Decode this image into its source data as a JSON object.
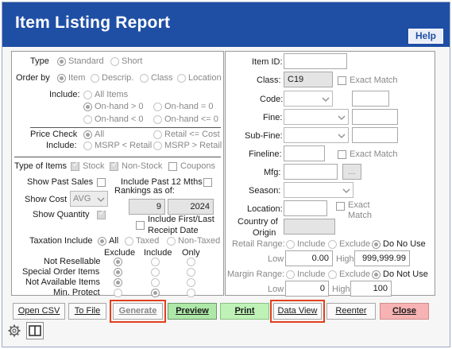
{
  "window": {
    "title": "Item Listing Report",
    "help_label": "Help"
  },
  "left": {
    "type_label": "Type",
    "type_opts": [
      "Standard",
      "Short"
    ],
    "orderby_label": "Order by",
    "orderby_opts": [
      "Item",
      "Descrip.",
      "Class",
      "Location"
    ],
    "include_label": "Include:",
    "include_opts": [
      "All Items",
      "On-hand > 0",
      "On-hand = 0",
      "On-hand < 0",
      "On-hand <= 0"
    ],
    "pricecheck_label1": "Price Check",
    "pricecheck_label2": "Include:",
    "pricecheck_opts": [
      "All",
      "Retail <= Cost",
      "MSRP < Retail",
      "MSRP > Retail"
    ],
    "typeitems_label": "Type of Items",
    "typeitems_opts": [
      "Stock",
      "Non-Stock",
      "Coupons"
    ],
    "show_past_sales": "Show Past Sales",
    "include_past12": "Include Past 12 Mths",
    "show_cost": "Show Cost",
    "cost_value": "AVG",
    "rankings_label": "Rankings as of:",
    "rank_month": "9",
    "rank_year": "2024",
    "show_quantity": "Show Quantity",
    "include_first_last1": "Include First/Last",
    "include_first_last2": "Receipt Date",
    "taxation_label": "Taxation Include",
    "tax_opts": [
      "All",
      "Taxed",
      "Non-Taxed"
    ],
    "grid_headers": [
      "Exclude",
      "Include",
      "Only"
    ],
    "grid_rows": [
      "Not Resellable",
      "Special Order Items",
      "Not Available Items",
      "Min. Protect"
    ]
  },
  "right": {
    "itemid_label": "Item ID:",
    "itemid_value": "",
    "class_label": "Class:",
    "class_value": "C19",
    "exact_match": "Exact Match",
    "code_label": "Code:",
    "fine_label": "Fine:",
    "subfine_label": "Sub-Fine:",
    "fineline_label": "Fineline:",
    "mfg_label": "Mfg:",
    "mfg_btn": "...",
    "season_label": "Season:",
    "location_label": "Location:",
    "exact_match_wrap1": "Exact",
    "exact_match_wrap2": "Match",
    "country_label1": "Country of",
    "country_label2": "Origin",
    "retail_range_label": "Retail Range:",
    "range_opts": [
      "Include",
      "Exclude",
      "Do No Use"
    ],
    "low_label": "Low",
    "high_label": "High",
    "retail_low": "0.00",
    "retail_high": "999,999.99",
    "margin_range_label": "Margin Range:",
    "margin_opts": [
      "Include",
      "Exclude",
      "Do Not Use"
    ],
    "margin_low": "0",
    "margin_high": "100"
  },
  "buttons": {
    "open_csv": "Open CSV",
    "to_file": "To File",
    "generate": "Generate",
    "preview": "Preview",
    "print": "Print",
    "data_view": "Data View",
    "reenter": "Reenter",
    "close": "Close"
  },
  "colors": {
    "title_bar": "#1f4fa5",
    "highlight": "#e2401c",
    "preview_bg": "#aee8a8",
    "print_bg": "#bff2b6",
    "close_bg": "#f7b3b3"
  }
}
